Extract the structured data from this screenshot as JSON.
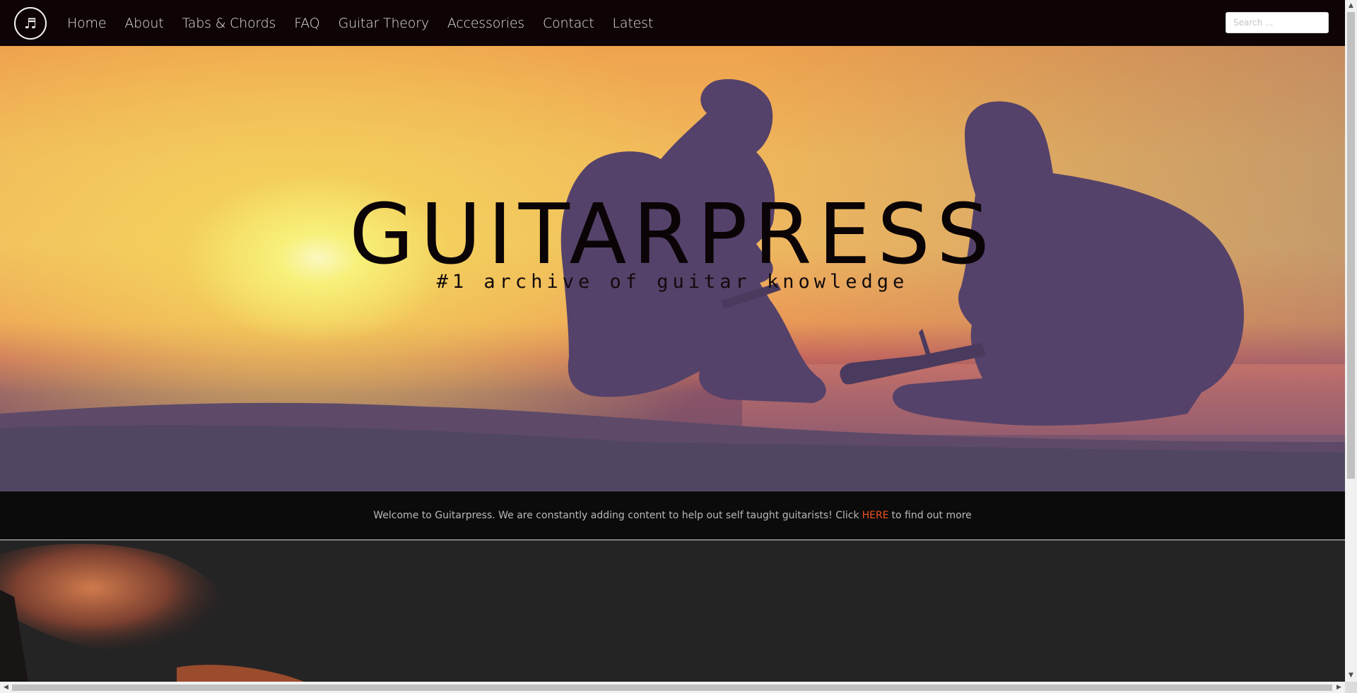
{
  "brand": {
    "logo_icon": "music-note-icon",
    "logo_glyph": "♬"
  },
  "nav": {
    "items": [
      {
        "label": "Home"
      },
      {
        "label": "About"
      },
      {
        "label": "Tabs & Chords"
      },
      {
        "label": "FAQ"
      },
      {
        "label": "Guitar Theory"
      },
      {
        "label": "Accessories"
      },
      {
        "label": "Contact"
      },
      {
        "label": "Latest"
      }
    ]
  },
  "search": {
    "placeholder": "Search ...",
    "value": ""
  },
  "hero": {
    "title": "GUITARPRESS",
    "subtitle": "#1 archive of guitar knowledge"
  },
  "welcome": {
    "text_before": "Welcome to Guitarpress. We are constantly adding content to help out self taught guitarists! Click",
    "link_label": "HERE",
    "text_after": "to find out more",
    "link_color": "#f0501e"
  },
  "colors": {
    "header_bg": "#0e0305",
    "strip_bg": "#0b0b0b",
    "lower_bg": "#252424"
  }
}
